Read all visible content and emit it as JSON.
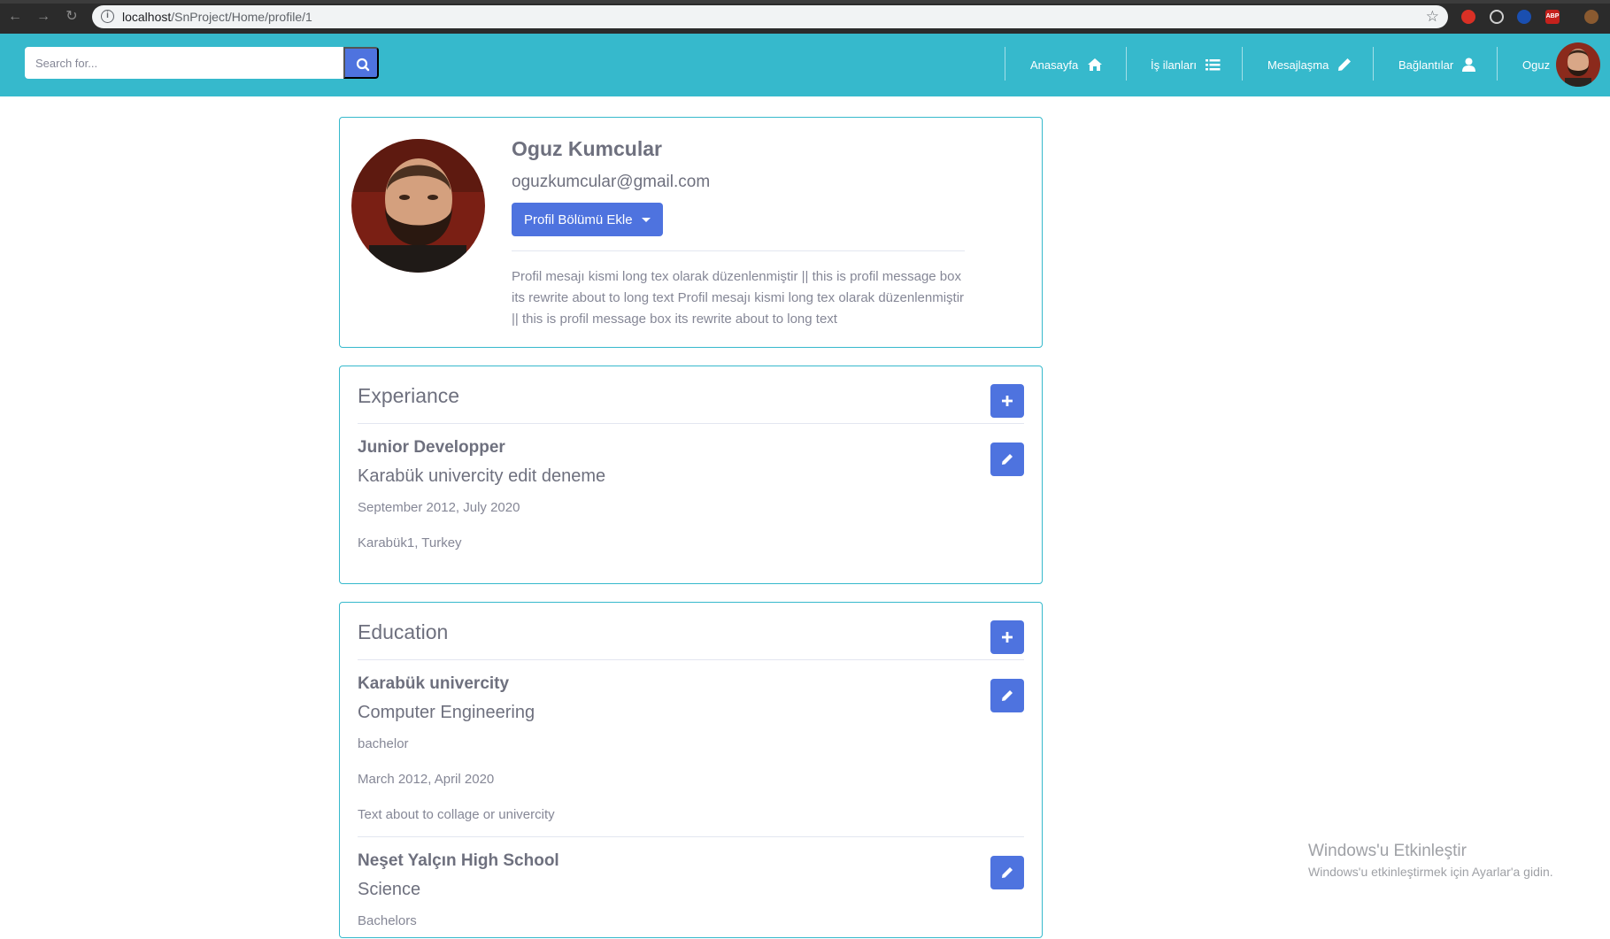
{
  "browser": {
    "url_host": "localhost",
    "url_path": "/SnProject/Home/profile/1",
    "extensions": [
      "ABP"
    ]
  },
  "navbar": {
    "search_placeholder": "Search for...",
    "items": [
      {
        "label": "Anasayfa",
        "icon": "home-icon"
      },
      {
        "label": "İş ilanları",
        "icon": "list-icon"
      },
      {
        "label": "Mesajlaşma",
        "icon": "pencil-icon"
      },
      {
        "label": "Bağlantılar",
        "icon": "user-icon"
      }
    ],
    "user_name": "Oguz"
  },
  "profile": {
    "name": "Oguz Kumcular",
    "email": "oguzkumcular@gmail.com",
    "add_section_label": "Profil Bölümü Ekle",
    "message": "Profil mesajı kismi long tex olarak düzenlenmiştir || this is profil message box its rewrite about to long text Profil mesajı kismi long tex olarak düzenlenmiştir || this is profil message box its rewrite about to long text"
  },
  "experience": {
    "title": "Experiance",
    "items": [
      {
        "title": "Junior Developper",
        "org": "Karabük univercity edit deneme",
        "dates": "September 2012, July 2020",
        "location": "Karabük1, Turkey"
      }
    ]
  },
  "education": {
    "title": "Education",
    "items": [
      {
        "school": "Karabük univercity",
        "field": "Computer Engineering",
        "degree": "bachelor",
        "dates": "March 2012, April 2020",
        "description": "Text about to collage or univercity"
      },
      {
        "school": "Neşet Yalçın High School",
        "field": "Science",
        "degree": "Bachelors"
      }
    ]
  },
  "watermark": {
    "line1": "Windows'u Etkinleştir",
    "line2": "Windows'u etkinleştirmek için Ayarlar'a gidin."
  },
  "colors": {
    "navbar": "#36b9cc",
    "primary": "#4e73df",
    "text": "#858796"
  }
}
